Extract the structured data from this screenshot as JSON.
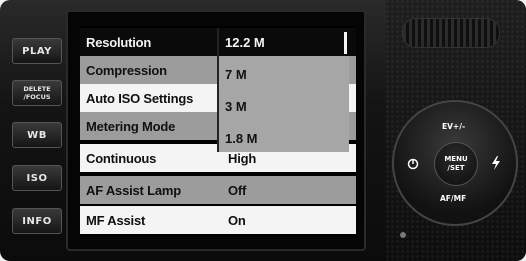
{
  "side_buttons": [
    {
      "label": "PLAY"
    },
    {
      "label": "DELETE",
      "label2": "/FOCUS"
    },
    {
      "label": "WB"
    },
    {
      "label": "ISO"
    },
    {
      "label": "INFO"
    }
  ],
  "menu": {
    "rows": [
      {
        "label": "Resolution",
        "value": "12.2 M"
      },
      {
        "label": "Compression",
        "value": ""
      },
      {
        "label": "Auto ISO Settings",
        "value": ""
      },
      {
        "label": "Metering Mode",
        "value": ""
      },
      {
        "label": "Continuous",
        "value": "High"
      },
      {
        "label": "AF Assist Lamp",
        "value": "Off"
      },
      {
        "label": "MF Assist",
        "value": "On"
      }
    ],
    "resolution_options": [
      "12.2 M",
      "7 M",
      "3 M",
      "1.8 M"
    ],
    "selected_option": "12.2 M"
  },
  "dial": {
    "top": "EV+/-",
    "bottom": "AF/MF",
    "center_line1": "MENU",
    "center_line2": "/SET",
    "left_icon": "self-timer-icon",
    "right_icon": "flash-icon"
  }
}
